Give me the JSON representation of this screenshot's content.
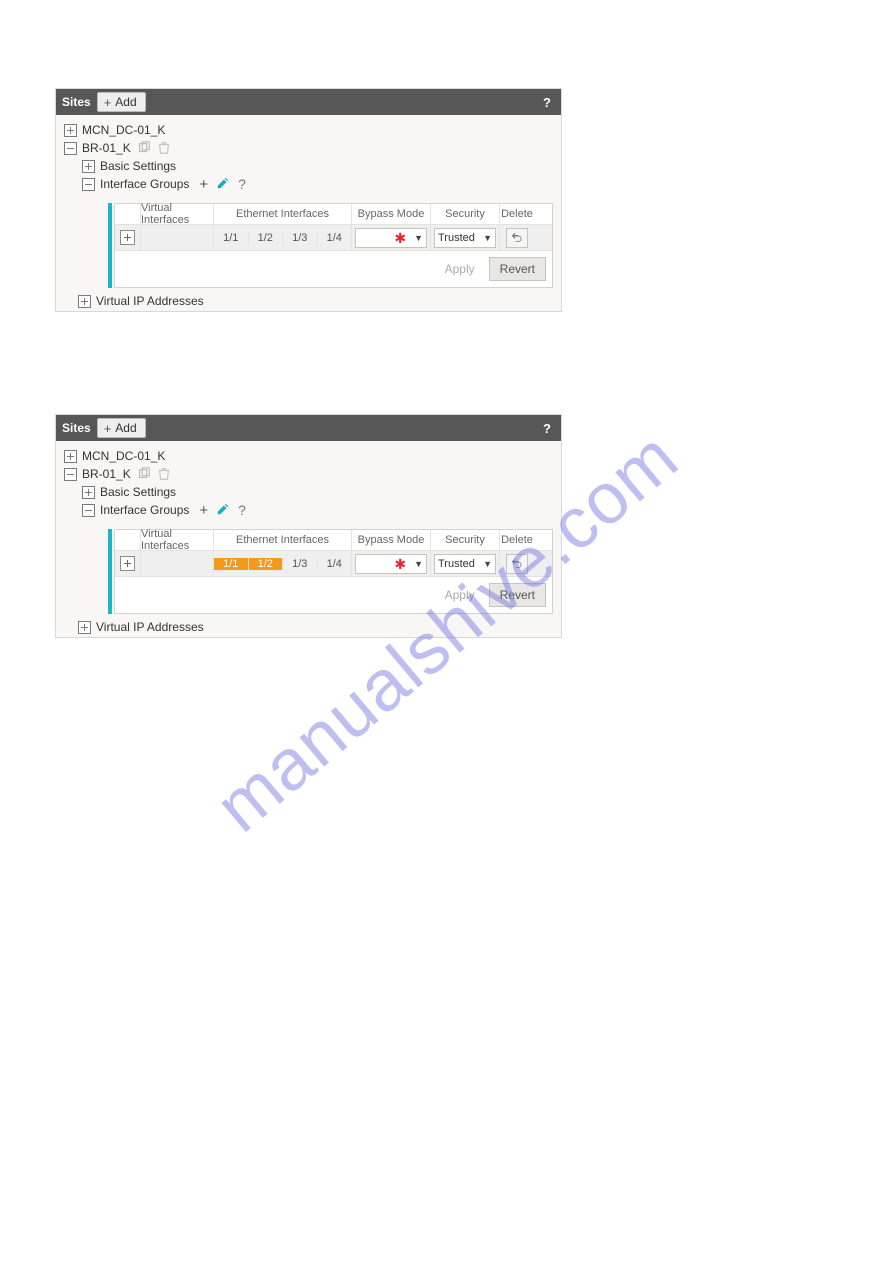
{
  "watermark": "manualshive.com",
  "panels": [
    {
      "title": "Sites",
      "add_label": "Add",
      "tree": {
        "item0": "MCN_DC-01_K",
        "item1": "BR-01_K",
        "basic": "Basic Settings",
        "ifg": "Interface Groups"
      },
      "grid": {
        "headers": {
          "vi": "Virtual Interfaces",
          "ei": "Ethernet Interfaces",
          "bm": "Bypass Mode",
          "sec": "Security",
          "del": "Delete"
        },
        "eth": [
          "1/1",
          "1/2",
          "1/3",
          "1/4"
        ],
        "eth_selected": [],
        "security_value": "Trusted",
        "apply": "Apply",
        "revert": "Revert"
      },
      "vip": "Virtual IP Addresses"
    },
    {
      "title": "Sites",
      "add_label": "Add",
      "tree": {
        "item0": "MCN_DC-01_K",
        "item1": "BR-01_K",
        "basic": "Basic Settings",
        "ifg": "Interface Groups"
      },
      "grid": {
        "headers": {
          "vi": "Virtual Interfaces",
          "ei": "Ethernet Interfaces",
          "bm": "Bypass Mode",
          "sec": "Security",
          "del": "Delete"
        },
        "eth": [
          "1/1",
          "1/2",
          "1/3",
          "1/4"
        ],
        "eth_selected": [
          0,
          1
        ],
        "security_value": "Trusted",
        "apply": "Apply",
        "revert": "Revert"
      },
      "vip": "Virtual IP Addresses"
    }
  ]
}
